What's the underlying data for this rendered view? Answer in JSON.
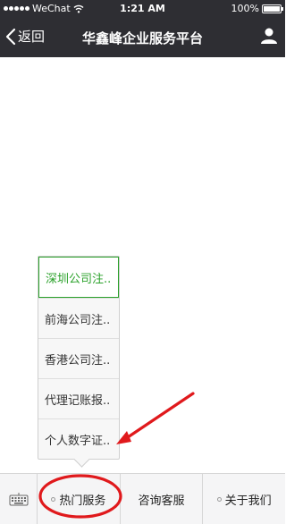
{
  "status_bar": {
    "carrier": "WeChat",
    "time": "1:21 AM",
    "battery": "100%"
  },
  "nav": {
    "back_label": "返回",
    "title": "华鑫峰企业服务平台",
    "icons": {
      "back": "chevron-left-icon",
      "profile": "person-icon"
    }
  },
  "popup_menu": {
    "items": [
      {
        "label": "深圳公司注..",
        "active": true
      },
      {
        "label": "前海公司注..",
        "active": false
      },
      {
        "label": "香港公司注..",
        "active": false
      },
      {
        "label": "代理记账报..",
        "active": false
      },
      {
        "label": "个人数字证..",
        "active": false
      }
    ]
  },
  "bottom_menu": {
    "keyboard_icon": "keyboard-icon",
    "buttons": [
      {
        "label": "热门服务",
        "has_submenu": true
      },
      {
        "label": "咨询客服",
        "has_submenu": false
      },
      {
        "label": "关于我们",
        "has_submenu": true
      }
    ]
  },
  "colors": {
    "nav_bg": "#2e2e33",
    "active_green": "#2aa12a",
    "annotation_red": "#e0191c"
  }
}
